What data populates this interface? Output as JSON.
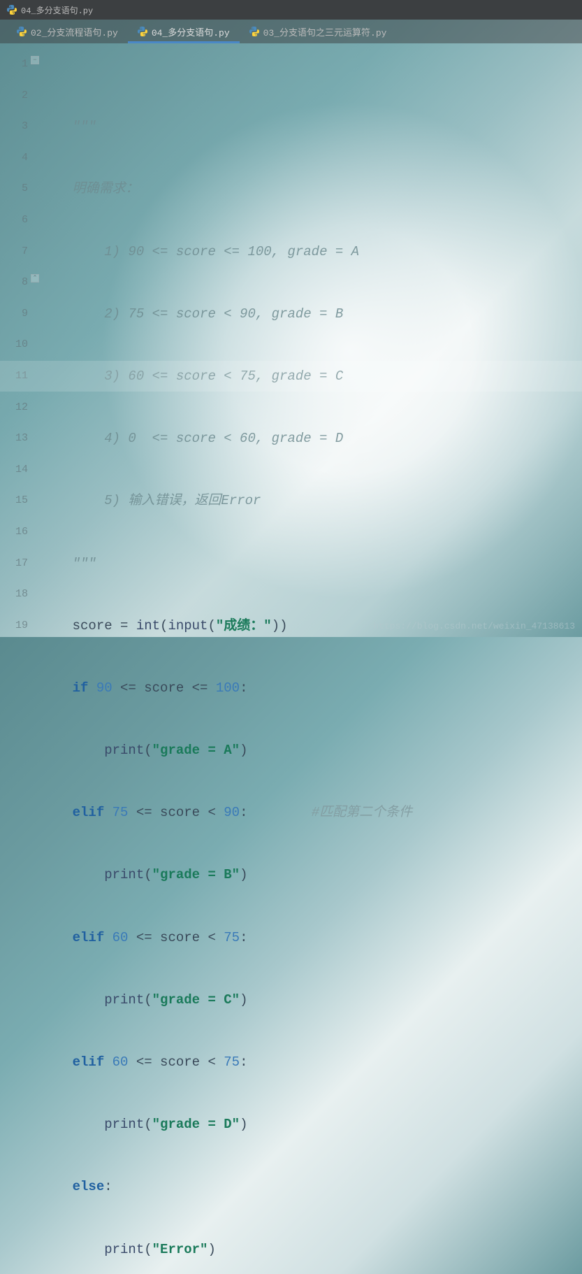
{
  "title_bar": {
    "filename": "04_多分支语句.py"
  },
  "tabs": [
    {
      "label": "02_分支流程语句.py",
      "active": false
    },
    {
      "label": "04_多分支语句.py",
      "active": true
    },
    {
      "label": "03_分支语句之三元运算符.py",
      "active": false
    }
  ],
  "gutter": {
    "lines": [
      "1",
      "2",
      "3",
      "4",
      "5",
      "6",
      "7",
      "8",
      "9",
      "10",
      "11",
      "12",
      "13",
      "14",
      "15",
      "16",
      "17",
      "18",
      "19"
    ]
  },
  "code": {
    "l1": "\"\"\"",
    "l2": "明确需求：",
    "l3": "    1) 90 <= score <= 100, grade = A",
    "l4": "    2) 75 <= score < 90, grade = B",
    "l5": "    3) 60 <= score < 75, grade = C",
    "l6": "    4) 0  <= score < 60, grade = D",
    "l7": "    5) 输入错误，返回Error",
    "l8": "\"\"\"",
    "l9_a": "score = ",
    "l9_b": "int",
    "l9_c": "(",
    "l9_d": "input",
    "l9_e": "(",
    "l9_f": "\"成绩：\"",
    "l9_g": "))",
    "l10_a": "if ",
    "l10_b": "90",
    "l10_c": " <= score <= ",
    "l10_d": "100",
    "l10_e": ":",
    "l11_a": "    ",
    "l11_b": "print",
    "l11_c": "(",
    "l11_d": "\"grade = A\"",
    "l11_e": ")",
    "l12_a": "elif ",
    "l12_b": "75",
    "l12_c": " <= score < ",
    "l12_d": "90",
    "l12_e": ":",
    "l12_comment": "        #匹配第二个条件",
    "l13_a": "    ",
    "l13_b": "print",
    "l13_c": "(",
    "l13_d": "\"grade = B\"",
    "l13_e": ")",
    "l14_a": "elif ",
    "l14_b": "60",
    "l14_c": " <= score < ",
    "l14_d": "75",
    "l14_e": ":",
    "l15_a": "    ",
    "l15_b": "print",
    "l15_c": "(",
    "l15_d": "\"grade = C\"",
    "l15_e": ")",
    "l16_a": "elif ",
    "l16_b": "60",
    "l16_c": " <= score < ",
    "l16_d": "75",
    "l16_e": ":",
    "l17_a": "    ",
    "l17_b": "print",
    "l17_c": "(",
    "l17_d": "\"grade = D\"",
    "l17_e": ")",
    "l18_a": "else",
    "l18_b": ":",
    "l19_a": "    ",
    "l19_b": "print",
    "l19_c": "(",
    "l19_d": "\"Error\"",
    "l19_e": ")"
  },
  "watermark": "https://blog.csdn.net/weixin_47138613"
}
